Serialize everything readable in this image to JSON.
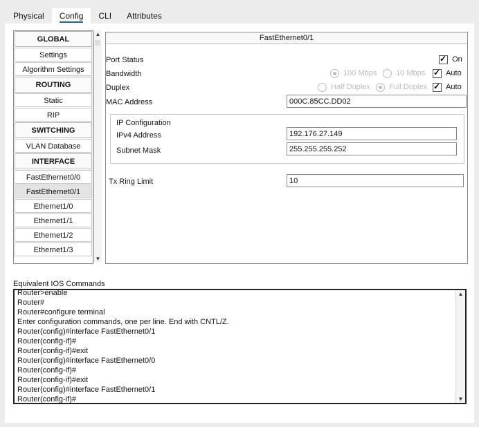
{
  "tabs": [
    {
      "label": "Physical"
    },
    {
      "label": "Config"
    },
    {
      "label": "CLI"
    },
    {
      "label": "Attributes"
    }
  ],
  "sidebar": {
    "items": [
      {
        "label": "GLOBAL",
        "kind": "header"
      },
      {
        "label": "Settings",
        "kind": "item"
      },
      {
        "label": "Algorithm Settings",
        "kind": "item"
      },
      {
        "label": "ROUTING",
        "kind": "header"
      },
      {
        "label": "Static",
        "kind": "item"
      },
      {
        "label": "RIP",
        "kind": "item"
      },
      {
        "label": "SWITCHING",
        "kind": "header"
      },
      {
        "label": "VLAN Database",
        "kind": "item"
      },
      {
        "label": "INTERFACE",
        "kind": "header"
      },
      {
        "label": "FastEthernet0/0",
        "kind": "item"
      },
      {
        "label": "FastEthernet0/1",
        "kind": "item",
        "selected": true
      },
      {
        "label": "Ethernet1/0",
        "kind": "item"
      },
      {
        "label": "Ethernet1/1",
        "kind": "item"
      },
      {
        "label": "Ethernet1/2",
        "kind": "item"
      },
      {
        "label": "Ethernet1/3",
        "kind": "item"
      }
    ]
  },
  "iface": {
    "title": "FastEthernet0/1",
    "port_status_label": "Port Status",
    "port_status_on_label": "On",
    "bandwidth_label": "Bandwidth",
    "bw_100": "100 Mbps",
    "bw_10": "10 Mbps",
    "bw_auto": "Auto",
    "duplex_label": "Duplex",
    "half_duplex": "Half Duplex",
    "full_duplex": "Full Duplex",
    "duplex_auto": "Auto",
    "mac_label": "MAC Address",
    "mac_value": "000C.85CC.DD02",
    "ip_config_label": "IP Configuration",
    "ipv4_label": "IPv4 Address",
    "ipv4_value": "192.176.27.149",
    "subnet_label": "Subnet Mask",
    "subnet_value": "255.255.255.252",
    "tx_ring_label": "Tx Ring Limit",
    "tx_ring_value": "10"
  },
  "ios": {
    "label": "Equivalent IOS Commands",
    "lines": [
      "Router>enable",
      "Router#",
      "Router#configure terminal",
      "Enter configuration commands, one per line.  End with CNTL/Z.",
      "Router(config)#interface FastEthernet0/1",
      "Router(config-if)#",
      "Router(config-if)#exit",
      "Router(config)#interface FastEthernet0/0",
      "Router(config-if)#",
      "Router(config-if)#exit",
      "Router(config)#interface FastEthernet0/1",
      "Router(config-if)#"
    ]
  }
}
